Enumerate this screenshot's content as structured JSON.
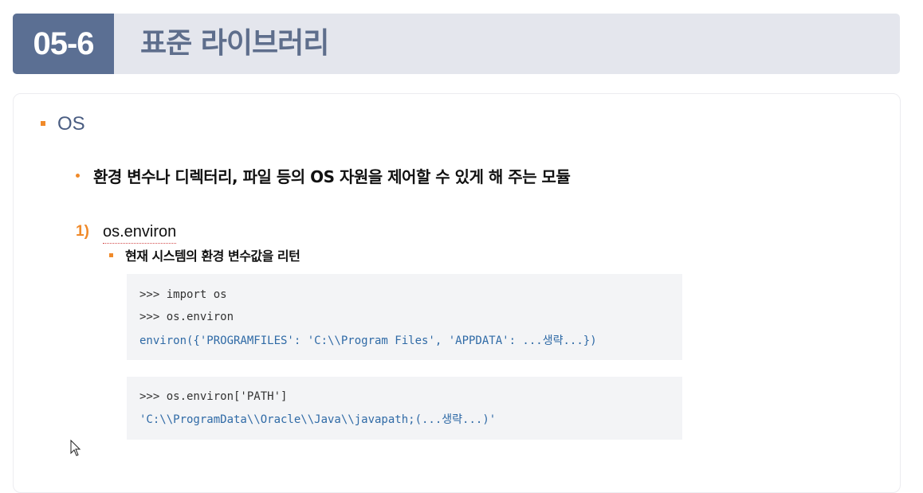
{
  "header": {
    "number": "05-6",
    "title": "표준 라이브러리"
  },
  "section": {
    "title": "OS"
  },
  "bullet": {
    "text": "환경 변수나 디렉터리, 파일 등의 OS 자원을 제어할 수 있게 해 주는 모듈"
  },
  "item": {
    "number": "1)",
    "name": "os.environ",
    "description": "현재 시스템의 환경 변수값을 리턴"
  },
  "code_blocks": [
    {
      "lines": [
        ">>> import os",
        ">>> os.environ",
        "environ({'PROGRAMFILES': 'C:\\\\Program Files', 'APPDATA': ...생략...})"
      ]
    },
    {
      "lines": [
        ">>> os.environ['PATH']",
        "'C:\\\\ProgramData\\\\Oracle\\\\Java\\\\javapath;(...생략...)'"
      ]
    }
  ],
  "colors": {
    "accent": "#f08a2a",
    "header_dark": "#5b6f93",
    "header_light": "#e4e6ed",
    "code_output": "#2f6aa6"
  },
  "icons": {
    "cursor": "mouse-pointer-icon"
  }
}
